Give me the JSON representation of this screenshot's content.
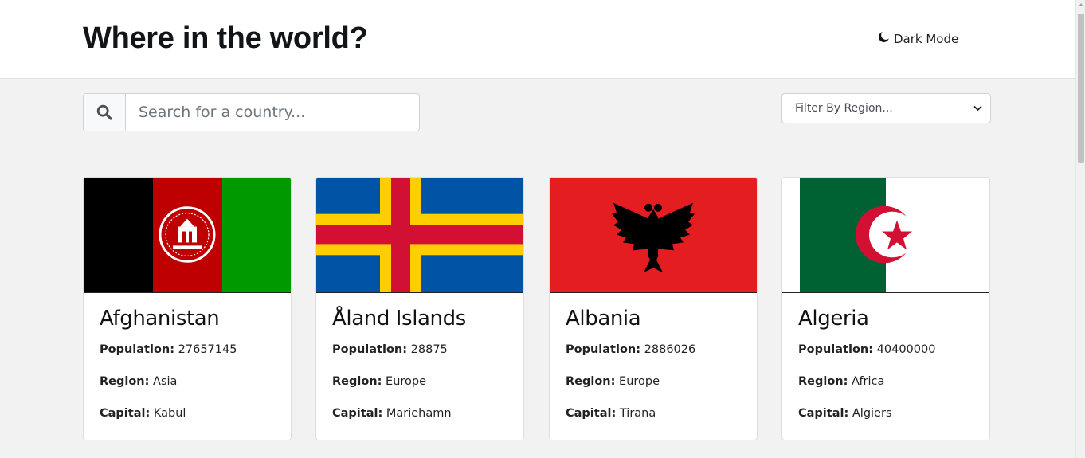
{
  "header": {
    "title": "Where in the world?",
    "dark_mode_label": "Dark Mode",
    "dark_mode_icon": "moon-icon"
  },
  "search": {
    "placeholder": "Search for a country...",
    "value": "",
    "icon": "search-icon"
  },
  "filter": {
    "selected": "Filter By Region...",
    "icon": "chevron-down-icon"
  },
  "labels": {
    "population": "Population:",
    "region": "Region:",
    "capital": "Capital:"
  },
  "countries": [
    {
      "name": "Afghanistan",
      "population": "27657145",
      "region": "Asia",
      "capital": "Kabul",
      "flag": "afghanistan-flag",
      "colors": [
        "#000000",
        "#be0000",
        "#009900"
      ]
    },
    {
      "name": "Åland Islands",
      "population": "28875",
      "region": "Europe",
      "capital": "Mariehamn",
      "flag": "aland-flag",
      "colors": [
        "#0053a5",
        "#ffce00",
        "#d21034"
      ]
    },
    {
      "name": "Albania",
      "population": "2886026",
      "region": "Europe",
      "capital": "Tirana",
      "flag": "albania-flag",
      "colors": [
        "#e41e20",
        "#000000"
      ]
    },
    {
      "name": "Algeria",
      "population": "40400000",
      "region": "Africa",
      "capital": "Algiers",
      "flag": "algeria-flag",
      "colors": [
        "#006233",
        "#ffffff",
        "#d21034"
      ]
    }
  ]
}
